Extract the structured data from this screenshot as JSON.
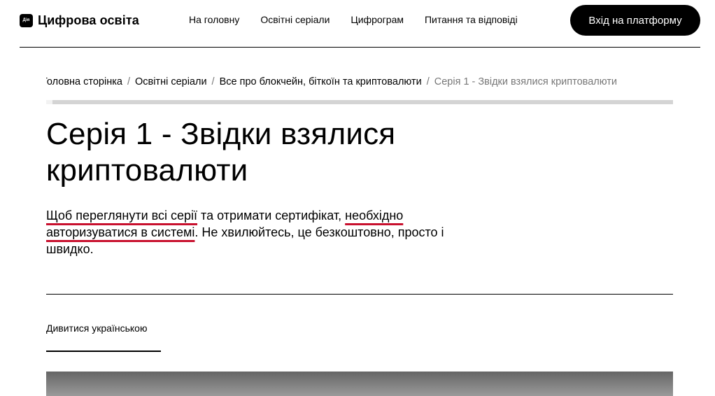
{
  "header": {
    "logo_mark": "Дія",
    "logo_text": "Цифрова освіта",
    "nav": [
      {
        "label": "На головну"
      },
      {
        "label": "Освітні серіали"
      },
      {
        "label": "Цифрограм"
      },
      {
        "label": "Питання та відповіді"
      }
    ],
    "login_label": "Вхід на платформу"
  },
  "breadcrumb": [
    {
      "label": "Головна сторінка"
    },
    {
      "label": "Освітні серіали"
    },
    {
      "label": "Все про блокчейн, біткоїн та криптовалюти"
    },
    {
      "label": "Серія 1 - Звідки взялися криптовалюти"
    }
  ],
  "breadcrumb_separator": "/",
  "progress": {
    "value_percent": 1
  },
  "page": {
    "title": "Серія 1 - Звідки взялися криптовалюти",
    "intro": {
      "part1": "Щоб переглянути всі серії",
      "part2": " та отримати сертифікат, ",
      "part3": "необхідно авторизуватися в системі",
      "part4": ". Не хвилюйтесь, це безкоштовно, просто і швидко."
    },
    "language_tab": "Дивитися українською"
  },
  "colors": {
    "underline": "#c8102e",
    "accent": "#000000"
  }
}
